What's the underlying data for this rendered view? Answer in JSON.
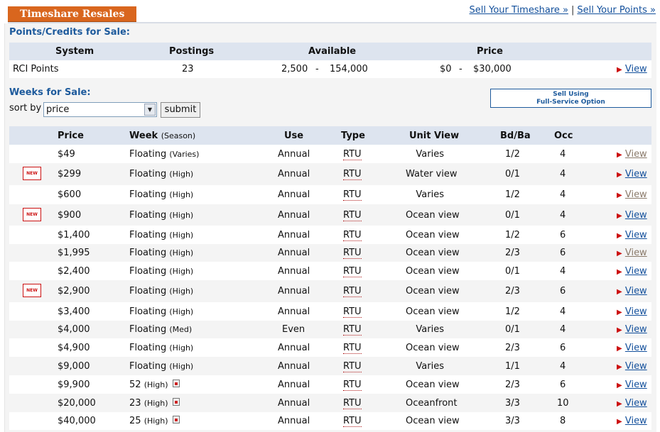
{
  "header": {
    "tab_label": "Timeshare Resales",
    "links": [
      "Sell Your Timeshare »",
      "Sell Your Points »"
    ],
    "separator": "|"
  },
  "points": {
    "title": "Points/Credits for Sale:",
    "columns": [
      "System",
      "Postings",
      "Available",
      "Price"
    ],
    "row": {
      "system": "RCI Points",
      "postings": "23",
      "avail_min": "2,500",
      "avail_max": "154,000",
      "price_min": "$0",
      "price_max": "$30,000",
      "dash": "-",
      "view": "View"
    }
  },
  "weeks": {
    "title": "Weeks for Sale:",
    "sort_label": "sort by",
    "sort_value": "price",
    "submit_label": "submit",
    "sell_box_line1": "Sell Using",
    "sell_box_line2": "Full-Service Option",
    "columns": [
      "Price",
      "Week",
      "(Season)",
      "Use",
      "Type",
      "Unit View",
      "Bd/Ba",
      "Occ"
    ],
    "new_badge": "NEW",
    "view_label": "View",
    "rows": [
      {
        "price": "$49",
        "week": "Floating",
        "season": "(Varies)",
        "cal": false,
        "use": "Annual",
        "type": "RTU",
        "unit_view": "Varies",
        "bdba": "1/2",
        "occ": "4",
        "is_new": false,
        "visited": true
      },
      {
        "price": "$299",
        "week": "Floating",
        "season": "(High)",
        "cal": false,
        "use": "Annual",
        "type": "RTU",
        "unit_view": "Water view",
        "bdba": "0/1",
        "occ": "4",
        "is_new": true,
        "visited": false
      },
      {
        "price": "$600",
        "week": "Floating",
        "season": "(High)",
        "cal": false,
        "use": "Annual",
        "type": "RTU",
        "unit_view": "Varies",
        "bdba": "1/2",
        "occ": "4",
        "is_new": false,
        "visited": true
      },
      {
        "price": "$900",
        "week": "Floating",
        "season": "(High)",
        "cal": false,
        "use": "Annual",
        "type": "RTU",
        "unit_view": "Ocean view",
        "bdba": "0/1",
        "occ": "4",
        "is_new": true,
        "visited": false
      },
      {
        "price": "$1,400",
        "week": "Floating",
        "season": "(High)",
        "cal": false,
        "use": "Annual",
        "type": "RTU",
        "unit_view": "Ocean view",
        "bdba": "1/2",
        "occ": "6",
        "is_new": false,
        "visited": false
      },
      {
        "price": "$1,995",
        "week": "Floating",
        "season": "(High)",
        "cal": false,
        "use": "Annual",
        "type": "RTU",
        "unit_view": "Ocean view",
        "bdba": "2/3",
        "occ": "6",
        "is_new": false,
        "visited": true
      },
      {
        "price": "$2,400",
        "week": "Floating",
        "season": "(High)",
        "cal": false,
        "use": "Annual",
        "type": "RTU",
        "unit_view": "Ocean view",
        "bdba": "0/1",
        "occ": "4",
        "is_new": false,
        "visited": false
      },
      {
        "price": "$2,900",
        "week": "Floating",
        "season": "(High)",
        "cal": false,
        "use": "Annual",
        "type": "RTU",
        "unit_view": "Ocean view",
        "bdba": "2/3",
        "occ": "6",
        "is_new": true,
        "visited": false
      },
      {
        "price": "$3,400",
        "week": "Floating",
        "season": "(High)",
        "cal": false,
        "use": "Annual",
        "type": "RTU",
        "unit_view": "Ocean view",
        "bdba": "1/2",
        "occ": "4",
        "is_new": false,
        "visited": false
      },
      {
        "price": "$4,000",
        "week": "Floating",
        "season": "(Med)",
        "cal": false,
        "use": "Even",
        "type": "RTU",
        "unit_view": "Varies",
        "bdba": "0/1",
        "occ": "4",
        "is_new": false,
        "visited": false
      },
      {
        "price": "$4,900",
        "week": "Floating",
        "season": "(High)",
        "cal": false,
        "use": "Annual",
        "type": "RTU",
        "unit_view": "Ocean view",
        "bdba": "2/3",
        "occ": "6",
        "is_new": false,
        "visited": false
      },
      {
        "price": "$9,000",
        "week": "Floating",
        "season": "(High)",
        "cal": false,
        "use": "Annual",
        "type": "RTU",
        "unit_view": "Varies",
        "bdba": "1/1",
        "occ": "4",
        "is_new": false,
        "visited": false
      },
      {
        "price": "$9,900",
        "week": "52",
        "season": "(High)",
        "cal": true,
        "use": "Annual",
        "type": "RTU",
        "unit_view": "Ocean view",
        "bdba": "2/3",
        "occ": "6",
        "is_new": false,
        "visited": false
      },
      {
        "price": "$20,000",
        "week": "23",
        "season": "(High)",
        "cal": true,
        "use": "Annual",
        "type": "RTU",
        "unit_view": "Oceanfront",
        "bdba": "3/3",
        "occ": "10",
        "is_new": false,
        "visited": false
      },
      {
        "price": "$40,000",
        "week": "25",
        "season": "(High)",
        "cal": true,
        "use": "Annual",
        "type": "RTU",
        "unit_view": "Ocean view",
        "bdba": "3/3",
        "occ": "8",
        "is_new": false,
        "visited": false
      }
    ]
  }
}
